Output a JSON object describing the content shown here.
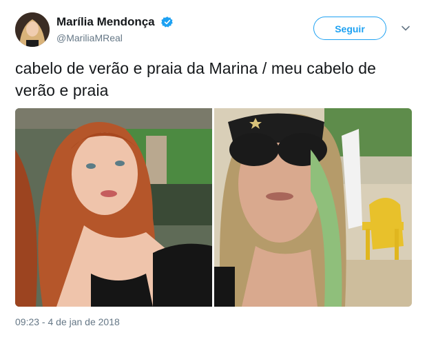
{
  "tweet": {
    "display_name": "Marília Mendonça",
    "username": "@MariliaMReal",
    "text": "cabelo de verão e praia da Marina / meu cabelo de verão e praia",
    "timestamp": "09:23 - 4 de jan de 2018"
  },
  "actions": {
    "follow_label": "Seguir"
  },
  "icons": {
    "verified": "verified-badge-icon",
    "more": "chevron-down-icon"
  },
  "colors": {
    "accent": "#1da1f2",
    "text": "#14171a",
    "muted": "#657786"
  }
}
